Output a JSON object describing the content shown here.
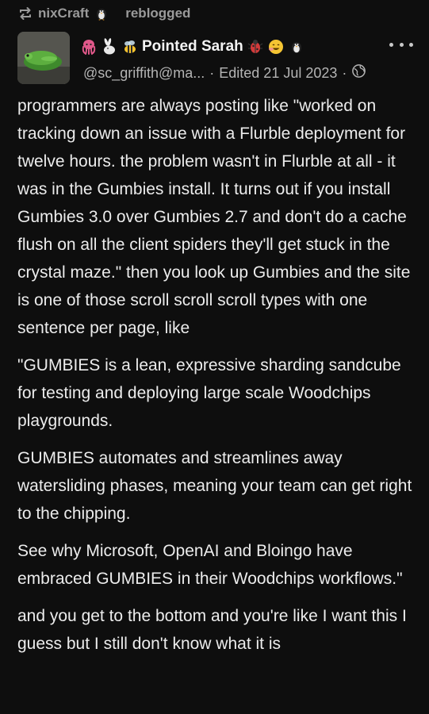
{
  "reblog": {
    "source": "nixCraft",
    "action": "reblogged",
    "source_icon": "penguin-icon",
    "icon": "reblog-icon"
  },
  "author": {
    "name": "Pointed Sarah",
    "handle": "@sc_griffith@ma...",
    "separator": "·",
    "edited": "Edited 21 Jul 2023",
    "avatar": "frog-avatar",
    "name_prefix_icons": [
      "octopus-icon",
      "rabbit-icon",
      "bee-icon"
    ],
    "name_suffix_icons": [
      "bug-icon",
      "smiling-face-icon",
      "penguin-icon"
    ],
    "visibility_icon": "globe-icon"
  },
  "menu": {
    "icon": "more-icon"
  },
  "body": {
    "paragraphs": [
      "programmers are always posting like \"worked on tracking down an issue with a Flurble deployment for twelve hours. the problem wasn't in Flurble at all - it was in the Gumbies install. It turns out if you install Gumbies 3.0 over Gumbies 2.7 and don't do a cache flush on all the client spiders they'll get stuck in the crystal maze.\" then you look up Gumbies and the site is one of those scroll scroll scroll types with one sentence per page, like",
      "\"GUMBIES is a lean, expressive sharding sandcube for testing and deploying large scale Woodchips playgrounds.",
      "GUMBIES automates and streamlines away watersliding phases, meaning your team can get right to the chipping.",
      "See why Microsoft, OpenAI and Bloingo have embraced GUMBIES in their Woodchips workflows.\"",
      "and you get to the bottom and you're like I want this I guess but I still don't know what it is"
    ]
  },
  "colors": {
    "background": "#0e0e0e",
    "text": "#ececec",
    "muted": "#9a9a9a"
  }
}
